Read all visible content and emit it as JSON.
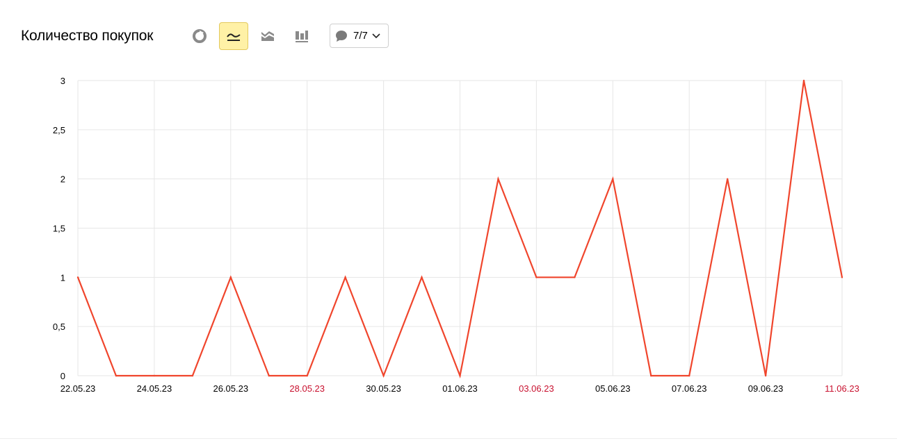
{
  "header": {
    "title": "Количество покупок",
    "view_buttons": [
      {
        "icon": "pie-chart-icon",
        "active": false
      },
      {
        "icon": "line-chart-icon",
        "active": true
      },
      {
        "icon": "stacked-area-icon",
        "active": false
      },
      {
        "icon": "bar-chart-icon",
        "active": false
      }
    ],
    "goals": {
      "icon": "comment-icon",
      "count": "7/7"
    }
  },
  "colors": {
    "series": "#f0452c",
    "grid": "#e6e6e6",
    "weekend_label": "#c8102e",
    "active_button_bg": "#fff1a6"
  },
  "chart_data": {
    "type": "line",
    "x": [
      "22.05.23",
      "23.05.23",
      "24.05.23",
      "25.05.23",
      "26.05.23",
      "27.05.23",
      "28.05.23",
      "29.05.23",
      "30.05.23",
      "31.05.23",
      "01.06.23",
      "02.06.23",
      "03.06.23",
      "04.06.23",
      "05.06.23",
      "06.06.23",
      "07.06.23",
      "08.06.23",
      "09.06.23",
      "10.06.23",
      "11.06.23"
    ],
    "series": [
      {
        "values": [
          1,
          0,
          0,
          0,
          1,
          0,
          0,
          1,
          0,
          1,
          0,
          2,
          1,
          1,
          2,
          0,
          0,
          2,
          0,
          3,
          1
        ]
      }
    ],
    "x_tick_labels": [
      {
        "label": "22.05.23",
        "weekend": false
      },
      {
        "label": "24.05.23",
        "weekend": false
      },
      {
        "label": "26.05.23",
        "weekend": false
      },
      {
        "label": "28.05.23",
        "weekend": true
      },
      {
        "label": "30.05.23",
        "weekend": false
      },
      {
        "label": "01.06.23",
        "weekend": false
      },
      {
        "label": "03.06.23",
        "weekend": true
      },
      {
        "label": "05.06.23",
        "weekend": false
      },
      {
        "label": "07.06.23",
        "weekend": false
      },
      {
        "label": "09.06.23",
        "weekend": false
      },
      {
        "label": "11.06.23",
        "weekend": true
      }
    ],
    "y_ticks": [
      0,
      0.5,
      1,
      1.5,
      2,
      2.5,
      3
    ],
    "y_tick_labels": [
      "0",
      "0,5",
      "1",
      "1,5",
      "2",
      "2,5",
      "3"
    ],
    "ylim": [
      0,
      3
    ],
    "grid": true,
    "legend": "none"
  }
}
